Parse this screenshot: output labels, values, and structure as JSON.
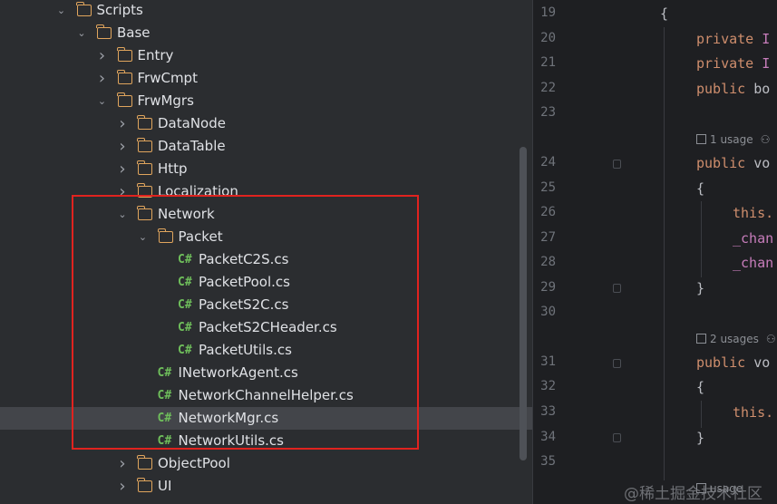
{
  "tree": {
    "items": [
      {
        "label": "Scripts",
        "type": "folder",
        "expanded": true
      },
      {
        "label": "Base",
        "type": "folder",
        "expanded": true
      },
      {
        "label": "Entry",
        "type": "folder",
        "expanded": false
      },
      {
        "label": "FrwCmpt",
        "type": "folder",
        "expanded": false
      },
      {
        "label": "FrwMgrs",
        "type": "folder",
        "expanded": true
      },
      {
        "label": "DataNode",
        "type": "folder",
        "expanded": false
      },
      {
        "label": "DataTable",
        "type": "folder",
        "expanded": false
      },
      {
        "label": "Http",
        "type": "folder",
        "expanded": false
      },
      {
        "label": "Localization",
        "type": "folder",
        "expanded": false
      },
      {
        "label": "Network",
        "type": "folder",
        "expanded": true
      },
      {
        "label": "Packet",
        "type": "folder",
        "expanded": true
      },
      {
        "label": "PacketC2S.cs",
        "type": "file",
        "icon": "C#"
      },
      {
        "label": "PacketPool.cs",
        "type": "file",
        "icon": "C#"
      },
      {
        "label": "PacketS2C.cs",
        "type": "file",
        "icon": "C#"
      },
      {
        "label": "PacketS2CHeader.cs",
        "type": "file",
        "icon": "C#"
      },
      {
        "label": "PacketUtils.cs",
        "type": "file",
        "icon": "C#"
      },
      {
        "label": "INetworkAgent.cs",
        "type": "file",
        "icon": "C#"
      },
      {
        "label": "NetworkChannelHelper.cs",
        "type": "file",
        "icon": "C#"
      },
      {
        "label": "NetworkMgr.cs",
        "type": "file",
        "icon": "C#",
        "selected": true
      },
      {
        "label": "NetworkUtils.cs",
        "type": "file",
        "icon": "C#"
      },
      {
        "label": "ObjectPool",
        "type": "folder",
        "expanded": false
      },
      {
        "label": "UI",
        "type": "folder",
        "expanded": false
      }
    ]
  },
  "editor": {
    "line_numbers": [
      "19",
      "20",
      "21",
      "22",
      "23",
      "24",
      "25",
      "26",
      "27",
      "28",
      "29",
      "30",
      "31",
      "32",
      "33",
      "34",
      "35"
    ],
    "code": {
      "l19": "{",
      "l20_kw": "private",
      "l20_rest": " I",
      "l21_kw": "private",
      "l21_rest": " I",
      "l22_kw": "public",
      "l22_rest": " bo",
      "l24_kw": "public",
      "l24_rest": " vo",
      "l25": "{",
      "l26": "this.",
      "l27": "_chan",
      "l28": "_chan",
      "l29": "}",
      "l31_kw": "public",
      "l31_rest": " vo",
      "l32": "{",
      "l33": "this.",
      "l34": "}"
    },
    "hints": {
      "h1": "1 usage",
      "h2": "2 usages",
      "h3": "usage"
    }
  },
  "watermark": "@稀土掘金技术社区",
  "colors": {
    "highlight": "#e0231f",
    "folder": "#e0a55d",
    "cs_icon": "#6fbf5b",
    "keyword": "#cf8e6d"
  }
}
